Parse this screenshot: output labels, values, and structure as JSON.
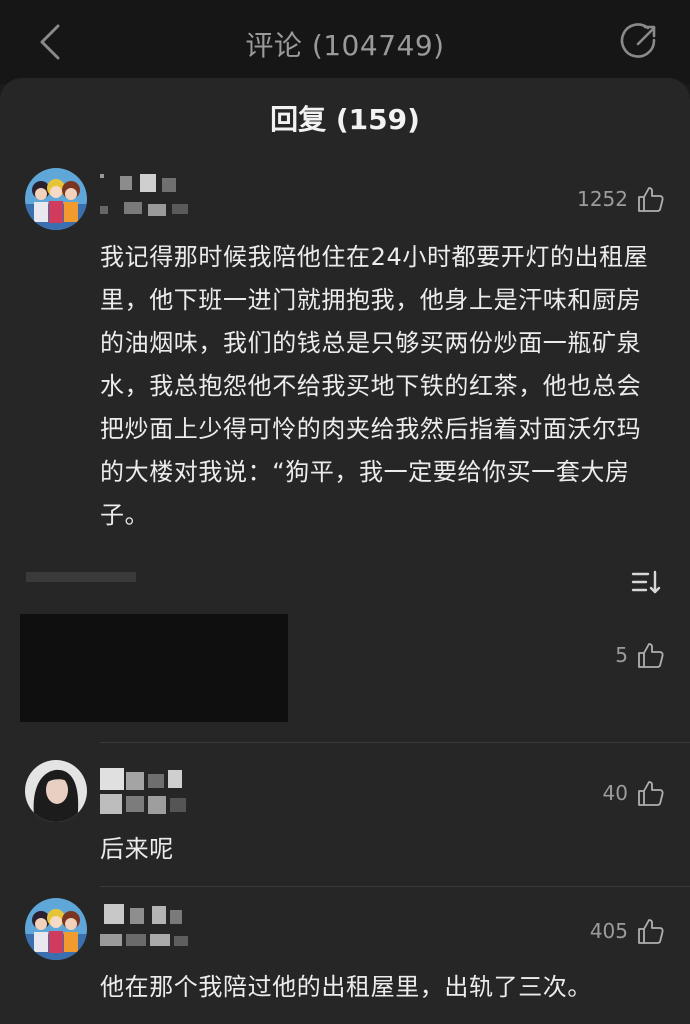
{
  "header": {
    "title": "评论 (104749)"
  },
  "sheet": {
    "title": "回复 (159)"
  },
  "main_comment": {
    "likes": "1252",
    "text": "我记得那时候我陪他住在24小时都要开灯的出租屋里，他下班一进门就拥抱我，他身上是汗味和厨房的油烟味，我们的钱总是只够买两份炒面一瓶矿泉水，我总抱怨他不给我买地下铁的红茶，他也总会把炒面上少得可怜的肉夹给我然后指着对面沃尔玛的大楼对我说：“狗平，我一定要给你买一套大房子。"
  },
  "redacted_reply": {
    "likes": "5"
  },
  "replies": [
    {
      "likes": "40",
      "text": "后来呢"
    },
    {
      "likes": "405",
      "text": "他在那个我陪过他的出租屋里，出轨了三次。"
    }
  ],
  "icons": {
    "back": "chevron-left-icon",
    "share": "share-icon",
    "like": "thumbs-up-icon",
    "sort": "sort-icon"
  }
}
